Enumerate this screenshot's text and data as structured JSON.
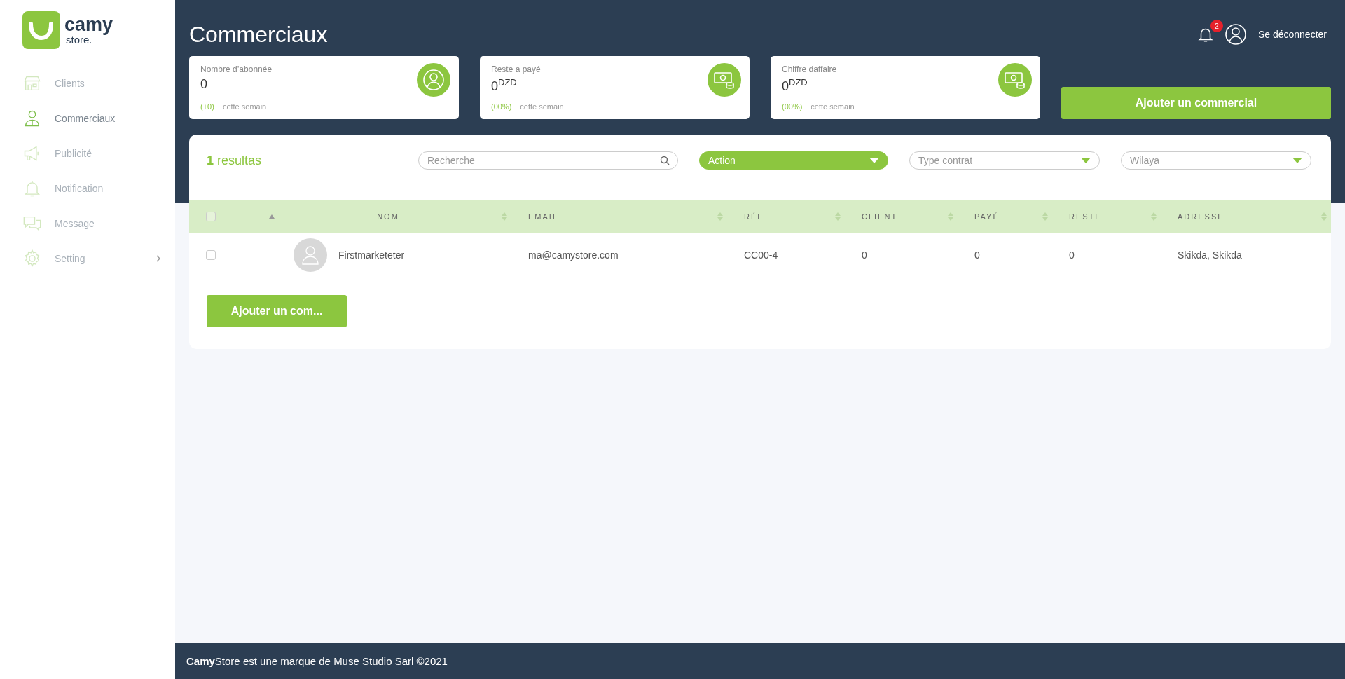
{
  "logo": {
    "name": "camy",
    "tagline": "store."
  },
  "sidebar": {
    "items": [
      {
        "label": "Clients",
        "selected": false
      },
      {
        "label": "Commerciaux",
        "selected": true
      },
      {
        "label": "Publicité",
        "selected": false
      },
      {
        "label": "Notification",
        "selected": false
      },
      {
        "label": "Message",
        "selected": false
      },
      {
        "label": "Setting",
        "selected": false,
        "expandable": true
      }
    ]
  },
  "header": {
    "title": "Commerciaux",
    "notification_count": "2",
    "logout": "Se déconnecter"
  },
  "stats": [
    {
      "label": "Nombre d’abonnée",
      "value": "0",
      "change": "(+0)",
      "period": "cette semain"
    },
    {
      "label": "Reste a payé",
      "value": "0",
      "unit": "DZD",
      "change": "(00%)",
      "period": "cette semain"
    },
    {
      "label": "Chiffre daffaire",
      "value": "0",
      "unit": "DZD",
      "change": "(00%)",
      "period": "cette semain"
    }
  ],
  "add_button": "Ajouter un commercial",
  "panel": {
    "results": "**1** resultas",
    "search": {
      "placeholder": "Recherche"
    },
    "filters": [
      {
        "kind": "action",
        "placeholder": "Action"
      },
      {
        "kind": "select",
        "placeholder": "Type contrat"
      },
      {
        "kind": "select",
        "placeholder": "Wilaya"
      }
    ],
    "table": {
      "select_all": {
        "checked": false
      },
      "columns": [
        "NOM",
        "EMAIL",
        "RÉF",
        "CLIENT",
        "PAYÉ",
        "RESTE",
        "ADRESSE"
      ],
      "rows": [
        {
          "checked": false,
          "cells": [
            "Firstmarketeter",
            "ma@camystore.com",
            "CC00-4",
            "0",
            "0",
            "0",
            "Skikda, Skikda"
          ]
        }
      ]
    },
    "add_button": "Ajouter un com..."
  },
  "footer": "**Camy**Store est une marque de Muse Studio Sarl ©2021"
}
